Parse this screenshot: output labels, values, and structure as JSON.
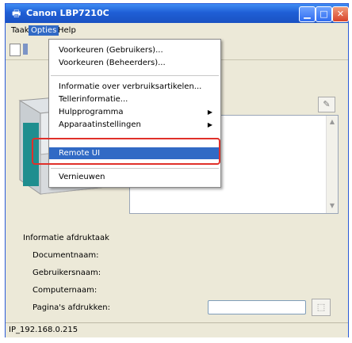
{
  "window": {
    "title": "Canon LBP7210C",
    "app_icon": "printer-icon"
  },
  "menubar": {
    "items": [
      "Taak",
      "Opties",
      "Help"
    ],
    "active": "Opties"
  },
  "dropdown": {
    "items": [
      {
        "label": "Voorkeuren (Gebruikers)...",
        "submenu": false
      },
      {
        "label": "Voorkeuren (Beheerders)...",
        "submenu": false
      },
      {
        "label": "Informatie over verbruiksartikelen...",
        "submenu": false
      },
      {
        "label": "Tellerinformatie...",
        "submenu": false
      },
      {
        "label": "Hulpprogramma",
        "submenu": true
      },
      {
        "label": "Apparaatinstellingen",
        "submenu": true
      },
      {
        "label": "Remote UI",
        "submenu": false,
        "selected": true
      },
      {
        "label": "Vernieuwen",
        "submenu": false
      }
    ]
  },
  "job_info": {
    "title": "Informatie afdruktaak",
    "document_name": "Documentnaam:",
    "user_name": "Gebruikersnaam:",
    "computer_name": "Computernaam:",
    "pages_printed": "Pagina's afdrukken:"
  },
  "statusbar": {
    "text": "IP_192.168.0.215"
  },
  "colors": {
    "titlebar": "#1f5fd6",
    "selection": "#316ac5",
    "highlight_border": "#e0302a"
  }
}
